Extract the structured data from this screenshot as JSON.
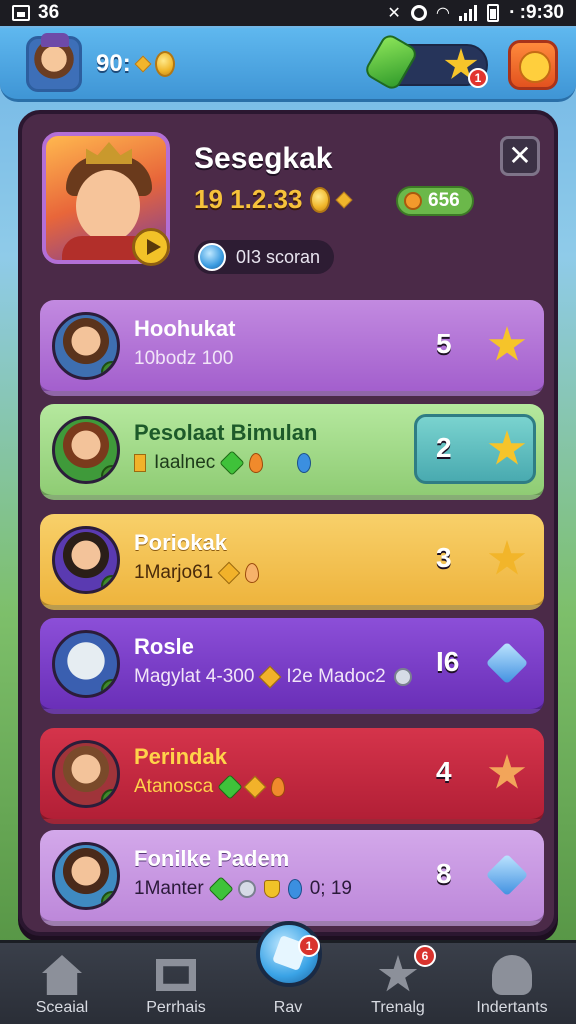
{
  "status_bar": {
    "left_text": "36",
    "time": "∙ :9:30"
  },
  "hud": {
    "coins": "90:",
    "notification_count": "1"
  },
  "profile": {
    "name": "Sesegkak",
    "score": "19 1.2.33",
    "gems": "656",
    "subtitle": "0I3 scoran"
  },
  "list": [
    {
      "name": "Hoohukat",
      "sub": "10bodz 100",
      "rank": "5",
      "icon": "star-icon",
      "color": "#b572d6",
      "name_color": "#ffffff",
      "sub_color": "#f1e4f8"
    },
    {
      "name": "Pesolaat Bimulan",
      "sub": "Iaalnec",
      "rank": "2",
      "icon": "star-icon",
      "color": "#9fd98a",
      "name_color": "#1d5a2a",
      "sub_color": "#1d3a1a"
    },
    {
      "name": "Poriokak",
      "sub": "1Marjo61",
      "rank": "3",
      "icon": "star-icon",
      "color": "#f3c24e",
      "name_color": "#ffffff",
      "sub_color": "#4a2a0a"
    },
    {
      "name": "Rosle",
      "sub": "Magylat 4-300",
      "sub2": "I2e Madoc2",
      "rank": "I6",
      "icon": "diamond-icon",
      "color": "#7a3fc8",
      "name_color": "#ffffff",
      "sub_color": "#f1e4f8"
    },
    {
      "name": "Perindak",
      "sub": "Atanosca",
      "rank": "4",
      "icon": "star-icon",
      "color": "#c6283f",
      "name_color": "#ffd24a",
      "sub_color": "#ffd24a"
    },
    {
      "name": "Fonilke Padem",
      "sub": "1Manter",
      "sub2": "0; 19",
      "rank": "8",
      "icon": "diamond-icon",
      "color": "#c99ae2",
      "name_color": "#2b1a3a",
      "sub_color": "#2b1a3a"
    }
  ],
  "bottom_nav": [
    {
      "label": "Sceaial",
      "icon": "home-icon"
    },
    {
      "label": "Perrhais",
      "icon": "frame-icon"
    },
    {
      "label": "Rav",
      "icon": "crystal-icon",
      "badge": "1"
    },
    {
      "label": "Trenalg",
      "icon": "star-icon",
      "badge": "6"
    },
    {
      "label": "Indertants",
      "icon": "person-icon"
    }
  ],
  "colors": {
    "panel": "#4b2a48",
    "accent_gold": "#f6c23b",
    "hud_blue": "#3f95d5"
  }
}
